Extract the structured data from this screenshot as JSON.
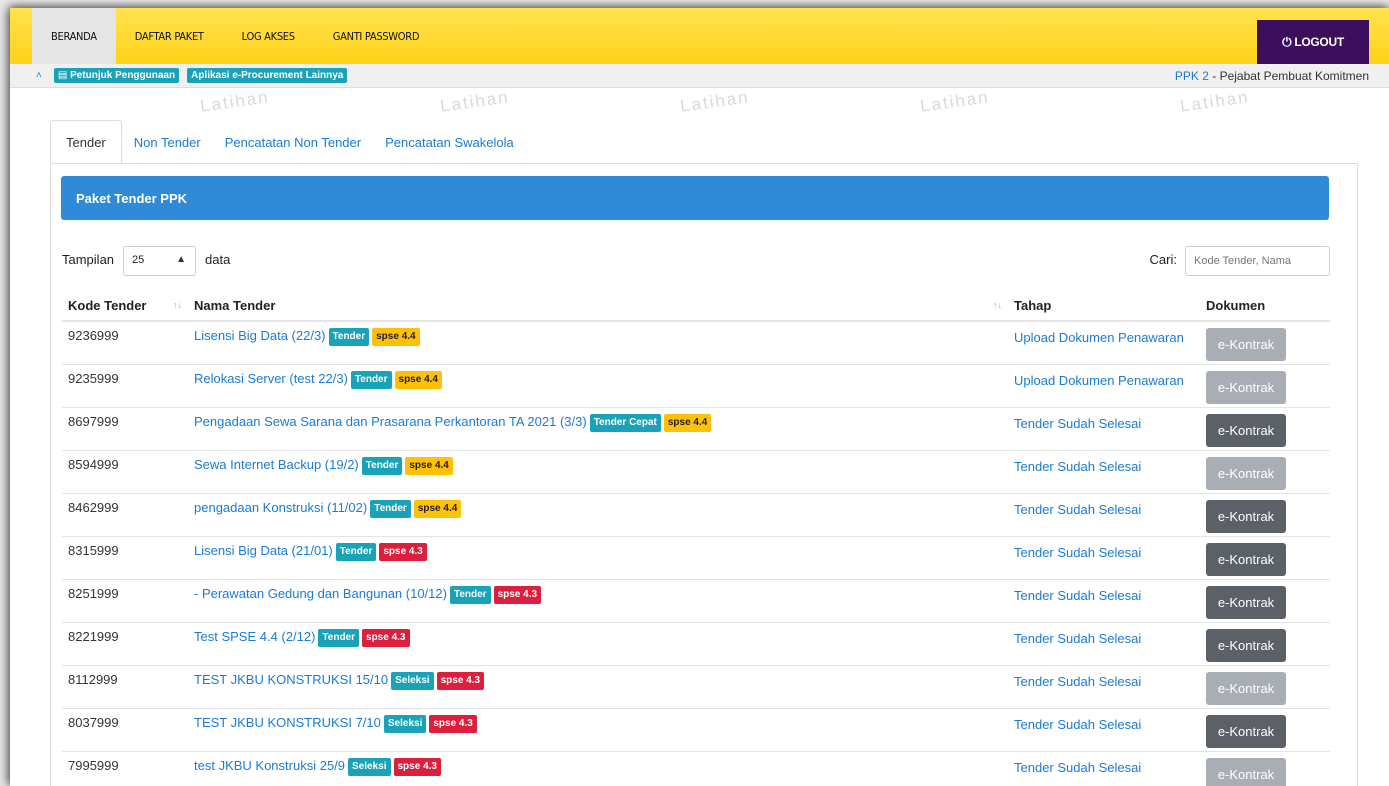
{
  "nav": {
    "items": [
      "BERANDA",
      "DAFTAR PAKET",
      "LOG AKSES",
      "GANTI PASSWORD"
    ],
    "active_index": 0,
    "logout_label": "LOGOUT"
  },
  "subbar": {
    "petunjuk": "Petunjuk Penggunaan",
    "aplikasi": "Aplikasi e-Procurement Lainnya",
    "role_link": "PPK 2",
    "role_rest": " - Pejabat Pembuat Komitmen"
  },
  "watermark": "Latihan",
  "tabs": [
    "Tender",
    "Non Tender",
    "Pencatatan Non Tender",
    "Pencatatan Swakelola"
  ],
  "panel": {
    "title": "Paket Tender PPK",
    "show_label": "Tampilan",
    "show_value": "25",
    "show_suffix": "data",
    "search_label": "Cari:",
    "search_placeholder": "Kode Tender, Nama"
  },
  "table": {
    "headers": {
      "kode": "Kode Tender",
      "nama": "Nama Tender",
      "tahap": "Tahap",
      "dokumen": "Dokumen"
    },
    "rows": [
      {
        "kode": "9236999",
        "nama": "Lisensi Big Data (22/3)",
        "jenis": "Tender",
        "versi": "spse 4.4",
        "tahap": "Upload Dokumen Penawaran",
        "dokumen": "e-Kontrak",
        "dok_enabled": false
      },
      {
        "kode": "9235999",
        "nama": "Relokasi Server (test 22/3)",
        "jenis": "Tender",
        "versi": "spse 4.4",
        "tahap": "Upload Dokumen Penawaran",
        "dokumen": "e-Kontrak",
        "dok_enabled": false
      },
      {
        "kode": "8697999",
        "nama": "Pengadaan Sewa Sarana dan Prasarana Perkantoran TA 2021 (3/3)",
        "jenis": "Tender Cepat",
        "versi": "spse 4.4",
        "tahap": "Tender Sudah Selesai",
        "dokumen": "e-Kontrak",
        "dok_enabled": true
      },
      {
        "kode": "8594999",
        "nama": "Sewa Internet Backup (19/2)",
        "jenis": "Tender",
        "versi": "spse 4.4",
        "tahap": "Tender Sudah Selesai",
        "dokumen": "e-Kontrak",
        "dok_enabled": false
      },
      {
        "kode": "8462999",
        "nama": "pengadaan Konstruksi (11/02)",
        "jenis": "Tender",
        "versi": "spse 4.4",
        "tahap": "Tender Sudah Selesai",
        "dokumen": "e-Kontrak",
        "dok_enabled": true
      },
      {
        "kode": "8315999",
        "nama": "Lisensi Big Data (21/01)",
        "jenis": "Tender",
        "versi": "spse 4.3",
        "tahap": "Tender Sudah Selesai",
        "dokumen": "e-Kontrak",
        "dok_enabled": true
      },
      {
        "kode": "8251999",
        "nama": "- Perawatan Gedung dan Bangunan (10/12)",
        "jenis": "Tender",
        "versi": "spse 4.3",
        "tahap": "Tender Sudah Selesai",
        "dokumen": "e-Kontrak",
        "dok_enabled": true
      },
      {
        "kode": "8221999",
        "nama": "Test SPSE 4.4 (2/12)",
        "jenis": "Tender",
        "versi": "spse 4.3",
        "tahap": "Tender Sudah Selesai",
        "dokumen": "e-Kontrak",
        "dok_enabled": true
      },
      {
        "kode": "8112999",
        "nama": "TEST JKBU KONSTRUKSI 15/10",
        "jenis": "Seleksi",
        "versi": "spse 4.3",
        "tahap": "Tender Sudah Selesai",
        "dokumen": "e-Kontrak",
        "dok_enabled": false
      },
      {
        "kode": "8037999",
        "nama": "TEST JKBU KONSTRUKSI 7/10",
        "jenis": "Seleksi",
        "versi": "spse 4.3",
        "tahap": "Tender Sudah Selesai",
        "dokumen": "e-Kontrak",
        "dok_enabled": true
      },
      {
        "kode": "7995999",
        "nama": "test JKBU Konstruksi 25/9",
        "jenis": "Seleksi",
        "versi": "spse 4.3",
        "tahap": "Tender Sudah Selesai",
        "dokumen": "e-Kontrak",
        "dok_enabled": false
      }
    ]
  }
}
